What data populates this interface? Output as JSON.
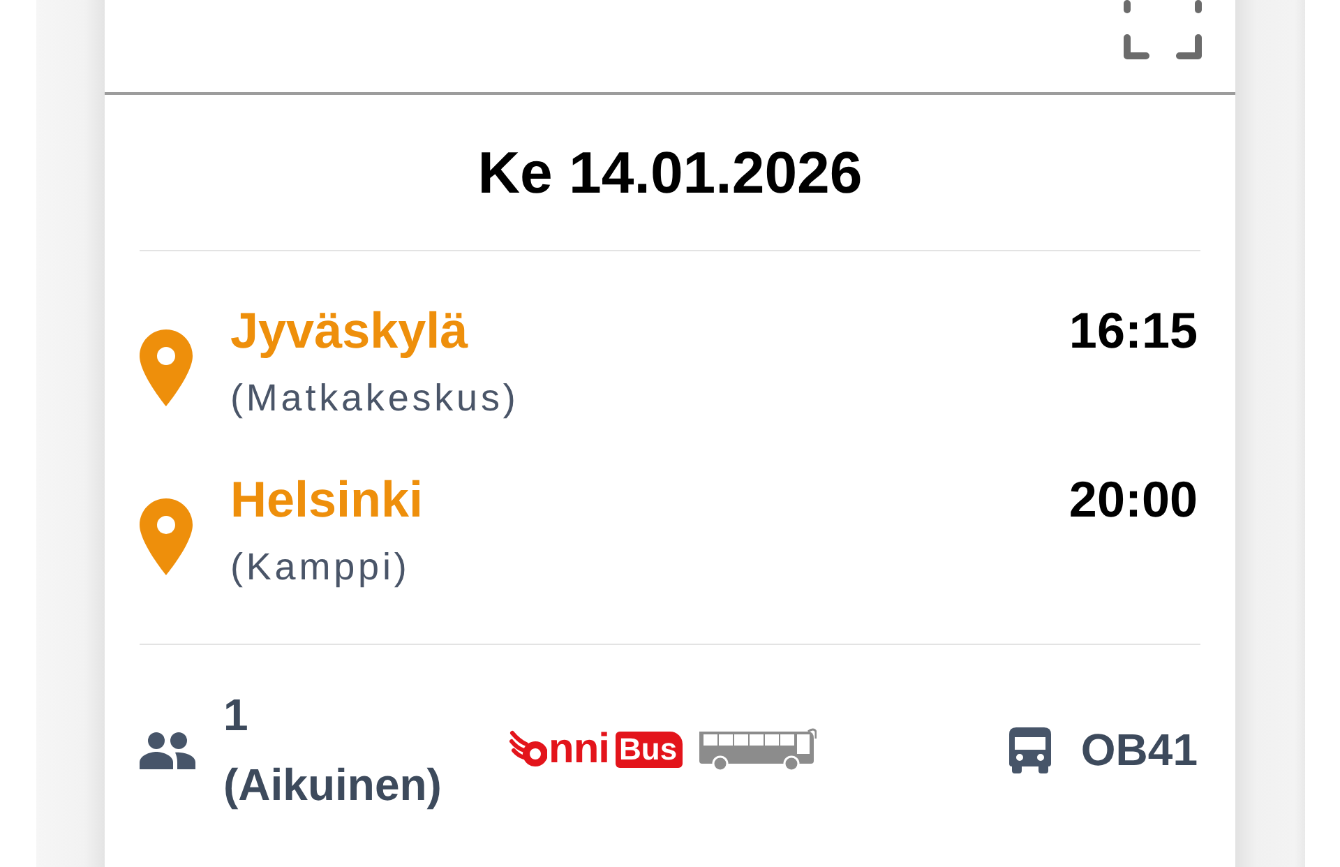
{
  "date": "Ke 14.01.2026",
  "stops": [
    {
      "city": "Jyväskylä",
      "station": "(Matkakeskus)",
      "time": "16:15"
    },
    {
      "city": "Helsinki",
      "station": "(Kamppi)",
      "time": "20:00"
    }
  ],
  "passengers": {
    "count": "1",
    "type": "(Aikuinen)"
  },
  "operator_logo": {
    "wordmark": "nni",
    "badge": "Bus"
  },
  "vehicle": {
    "line": "OB41"
  }
}
